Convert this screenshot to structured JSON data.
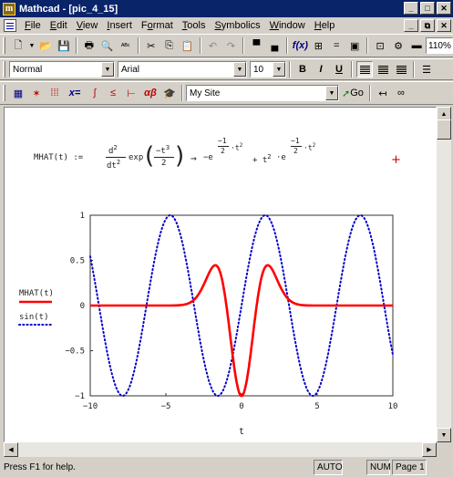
{
  "window": {
    "title": "Mathcad - [pic_4_15]",
    "app_icon": "m",
    "controls": [
      "minimize-icon",
      "maximize-icon",
      "close-icon"
    ]
  },
  "menu": {
    "items": [
      "File",
      "Edit",
      "View",
      "Insert",
      "Format",
      "Tools",
      "Symbolics",
      "Window",
      "Help"
    ],
    "mnemonics": [
      "F",
      "E",
      "V",
      "I",
      "o",
      "T",
      "S",
      "W",
      "H"
    ]
  },
  "toolbar_standard": {
    "zoom": "110%"
  },
  "toolbar_format": {
    "style": "Normal",
    "font": "Arial",
    "size": "10",
    "bold": "B",
    "italic": "I",
    "underline": "U"
  },
  "toolbar_math": {
    "resource": "My Site",
    "go_label": "Go",
    "xeq": "x=",
    "alpha_beta": "αβ"
  },
  "equation": {
    "lhs": "MHAT(t) :=",
    "d2": "d",
    "dt2": "dt",
    "exp": "exp",
    "neg_t3": "−t",
    "two": "2",
    "arrow": "→",
    "minus_e": "−e",
    "neg1a": "−1",
    "two_a": "2",
    "dot_t2a": "·t",
    "plus_t2": "+ t",
    "dot_e": "·e",
    "neg1b": "−1",
    "two_b": "2",
    "dot_t2b": "·t",
    "sup2": "2",
    "sup3": "3"
  },
  "chart_data": {
    "type": "line",
    "xlabel": "t",
    "xlim": [
      -10,
      10
    ],
    "ylim": [
      -1,
      1
    ],
    "x_ticks": [
      "−10",
      "−5",
      "0",
      "5",
      "10"
    ],
    "y_ticks": [
      "1",
      "0.5",
      "0",
      "−0.5",
      "−1"
    ],
    "series": [
      {
        "name": "MHAT(t)",
        "expression": "(t^2 - 1)*exp(-t^2/2)",
        "color": "#ff0000",
        "style": "solid"
      },
      {
        "name": "sin(t)",
        "expression": "sin(t)",
        "color": "#0000c8",
        "style": "dotted"
      }
    ]
  },
  "status": {
    "help": "Press F1 for help.",
    "mode": "AUTO",
    "num": "NUM",
    "page": "Page 1"
  },
  "colors": {
    "titlebar": "#0a246a",
    "chrome": "#d4d0c8",
    "mhat": "#ff0000",
    "sin": "#0000c8",
    "cursor": "#d00000"
  }
}
